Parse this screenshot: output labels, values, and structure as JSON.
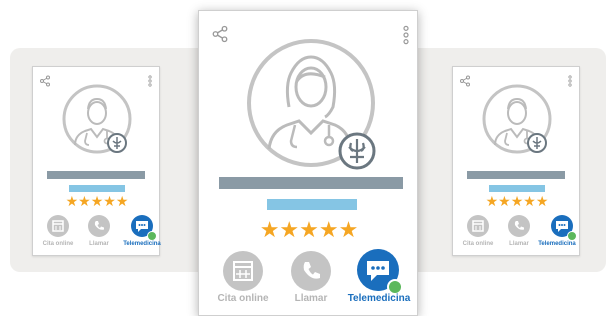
{
  "colors": {
    "backdrop": "#efeeec",
    "bar_dark": "#8a9aa5",
    "bar_light": "#85c5e4",
    "star": "#f5a623",
    "inactive_action": "#c4c4c4",
    "active_action": "#1a6ebd",
    "check_badge": "#5cb85c"
  },
  "icons": {
    "share": "share-icon",
    "more": "more-vertical-icon",
    "avatar": "doctor-avatar-icon",
    "emblem": "medical-emblem-icon",
    "calendar": "calendar-icon",
    "phone": "phone-icon",
    "chat": "chat-icon",
    "check": "check-icon"
  },
  "cards": [
    {
      "id": "left",
      "avatar_gender": "male",
      "rating_stars": "★★★★★",
      "rating": 5,
      "actions": [
        {
          "label": "Cita online",
          "active": false
        },
        {
          "label": "Llamar",
          "active": false
        },
        {
          "label": "Telemedicina",
          "active": true
        }
      ]
    },
    {
      "id": "center",
      "avatar_gender": "female",
      "rating_stars": "★★★★★",
      "rating": 5,
      "actions": [
        {
          "label": "Cita online",
          "active": false
        },
        {
          "label": "Llamar",
          "active": false
        },
        {
          "label": "Telemedicina",
          "active": true
        }
      ]
    },
    {
      "id": "right",
      "avatar_gender": "male",
      "rating_stars": "★★★★★",
      "rating": 5,
      "actions": [
        {
          "label": "Cita online",
          "active": false
        },
        {
          "label": "Llamar",
          "active": false
        },
        {
          "label": "Telemedicina",
          "active": true
        }
      ]
    }
  ]
}
